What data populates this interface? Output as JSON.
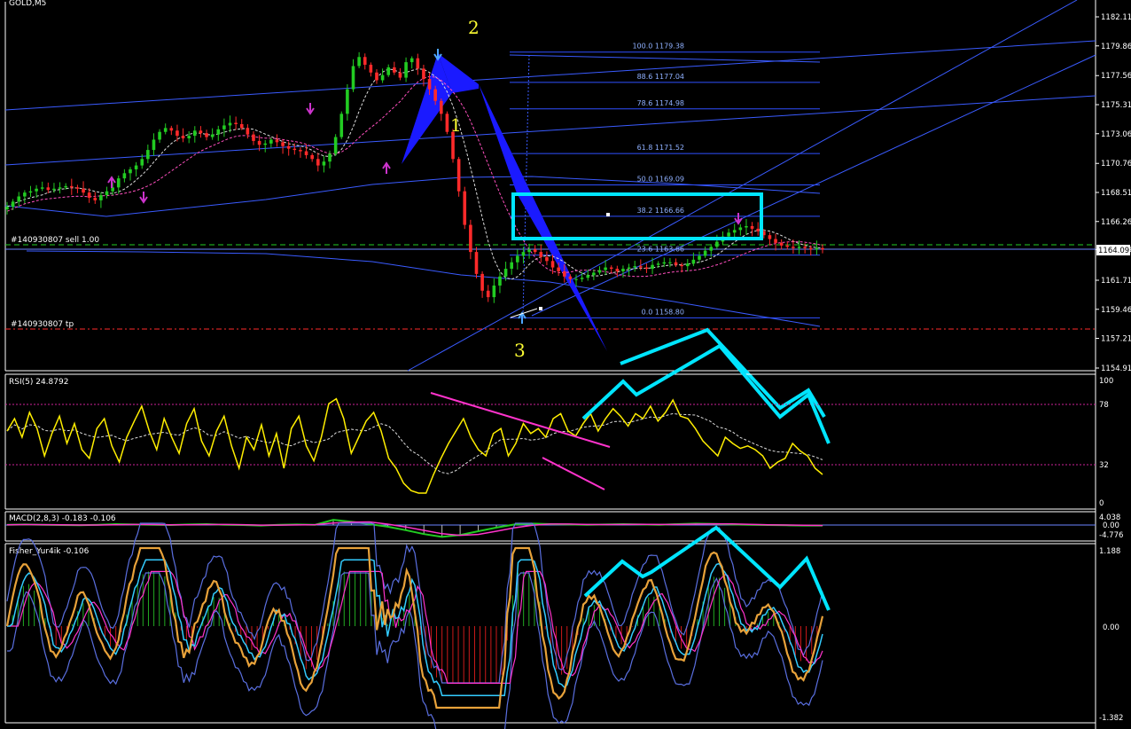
{
  "colors": {
    "background": "#000000",
    "bull": "#22cc22",
    "bear": "#ff2a2a",
    "rsi": "#ffee00",
    "cyan": "#00e5ff",
    "blue_line": "#3a5bff",
    "magenta": "#ff33cc",
    "fisher_orange": "#e8a23a",
    "fisher_blue": "#6b84ff"
  },
  "main_panel": {
    "symbol": "GOLD,M5",
    "order_label": "#140930807 sell 1.00",
    "tp_label": "#140930807 tp",
    "current_price": "1164.09",
    "price_ticks": [
      "1182.11",
      "1179.86",
      "1177.56",
      "1175.31",
      "1173.06",
      "1170.76",
      "1168.51",
      "1166.26",
      "1164.09",
      "1161.71",
      "1159.46",
      "1157.21",
      "1154.91"
    ],
    "wave_labels": [
      "2",
      "1",
      "3"
    ],
    "fib_levels": [
      "100.0  1179.38",
      "88.6  1177.04",
      "78.6  1174.98",
      "61.8  1171.52",
      "50.0  1169.09",
      "38.2  1166.66",
      "23.6  1163.66",
      "0.0  1158.80"
    ]
  },
  "rsi_panel": {
    "label": "RSI(5) 24.8792",
    "ticks": [
      "100",
      "78",
      "32",
      "0"
    ]
  },
  "macd_panel": {
    "label": "MACD(2,8,3) -0.183 -0.106",
    "ticks": [
      "4.038",
      "0.00",
      "-4.776"
    ]
  },
  "fisher_panel": {
    "label": "Fisher_Yur4ik -0.106",
    "ticks": [
      "1.188",
      "0.00",
      "-1.382"
    ]
  },
  "chart_data": {
    "type": "line",
    "title": "GOLD,M5",
    "ylim": [
      1154.91,
      1182.11
    ],
    "close": [
      1167.4,
      1167.8,
      1168.2,
      1168.5,
      1168.6,
      1168.8,
      1168.9,
      1168.7,
      1168.8,
      1168.9,
      1169.0,
      1168.9,
      1168.8,
      1168.5,
      1168.1,
      1167.9,
      1168.3,
      1168.6,
      1168.9,
      1169.6,
      1170.0,
      1170.3,
      1170.6,
      1171.1,
      1171.8,
      1172.6,
      1173.2,
      1173.5,
      1173.3,
      1172.9,
      1172.7,
      1172.9,
      1173.3,
      1173.1,
      1172.8,
      1173.0,
      1173.4,
      1173.7,
      1173.9,
      1173.8,
      1173.5,
      1173.0,
      1172.5,
      1172.2,
      1172.3,
      1172.6,
      1172.4,
      1172.1,
      1171.9,
      1171.8,
      1171.7,
      1171.4,
      1171.1,
      1170.6,
      1170.9,
      1171.5,
      1172.8,
      1174.6,
      1176.5,
      1178.3,
      1179.0,
      1178.4,
      1177.8,
      1177.2,
      1177.6,
      1178.2,
      1177.8,
      1177.4,
      1178.6,
      1178.9,
      1178.1,
      1177.3,
      1176.5,
      1175.6,
      1174.6,
      1173.2,
      1171.1,
      1168.6,
      1166.0,
      1163.9,
      1162.2,
      1160.9,
      1160.4,
      1161.3,
      1162.0,
      1162.6,
      1163.1,
      1163.6,
      1163.9,
      1164.1,
      1163.9,
      1163.5,
      1163.2,
      1162.7,
      1162.4,
      1162.0,
      1161.8,
      1161.8,
      1161.9,
      1162.1,
      1162.3,
      1162.5,
      1162.7,
      1162.6,
      1162.4,
      1162.6,
      1162.7,
      1162.8,
      1162.7,
      1162.6,
      1162.9,
      1163.0,
      1163.1,
      1163.1,
      1162.9,
      1162.8,
      1163.0,
      1163.3,
      1163.6,
      1164.0,
      1164.3,
      1164.7,
      1165.1,
      1165.4,
      1165.6,
      1165.8,
      1165.9,
      1165.7,
      1165.5,
      1165.2,
      1164.9,
      1164.6,
      1164.4,
      1164.3,
      1164.2,
      1164.3,
      1164.2,
      1164.1,
      1164.2,
      1164.1
    ],
    "series": [
      {
        "name": "RSI(5)",
        "values": [
          60,
          70,
          55,
          75,
          62,
          40,
          58,
          72,
          50,
          66,
          45,
          38,
          62,
          70,
          48,
          35,
          55,
          68,
          80,
          60,
          45,
          70,
          55,
          42,
          66,
          78,
          52,
          40,
          60,
          72,
          48,
          30,
          55,
          45,
          65,
          40,
          58,
          30,
          62,
          72,
          48,
          36,
          55,
          82,
          86,
          70,
          42,
          55,
          68,
          75,
          60,
          38,
          30,
          18,
          12,
          10,
          10,
          25,
          38,
          50,
          60,
          70,
          55,
          45,
          40,
          58,
          62,
          40,
          50,
          66,
          58,
          62,
          55,
          70,
          74,
          60,
          56,
          66,
          74,
          60,
          70,
          78,
          72,
          64,
          74,
          70,
          80,
          68,
          75,
          85,
          72,
          70,
          62,
          52,
          46,
          40,
          55,
          50,
          46,
          48,
          45,
          40,
          30,
          35,
          38,
          50,
          44,
          40,
          30,
          25
        ]
      },
      {
        "name": "MACD(2,8,3)",
        "values": [
          0.1,
          0.2,
          0.1,
          0.0,
          -0.1,
          0.1,
          0.3,
          0.2,
          0.1,
          0.0,
          0.2,
          0.3,
          0.1,
          0.0,
          -0.2,
          0.1,
          0.2,
          0.1,
          1.8,
          1.2,
          0.3,
          -0.6,
          -1.8,
          -3.2,
          -4.2,
          -3.5,
          -2.2,
          -0.9,
          0.2,
          0.5,
          0.3,
          0.2,
          0.1,
          0.2,
          0.3,
          0.2,
          0.1,
          0.3,
          0.5,
          0.4,
          0.2,
          0.1,
          0.0,
          -0.1,
          -0.2,
          -0.18
        ]
      }
    ]
  }
}
